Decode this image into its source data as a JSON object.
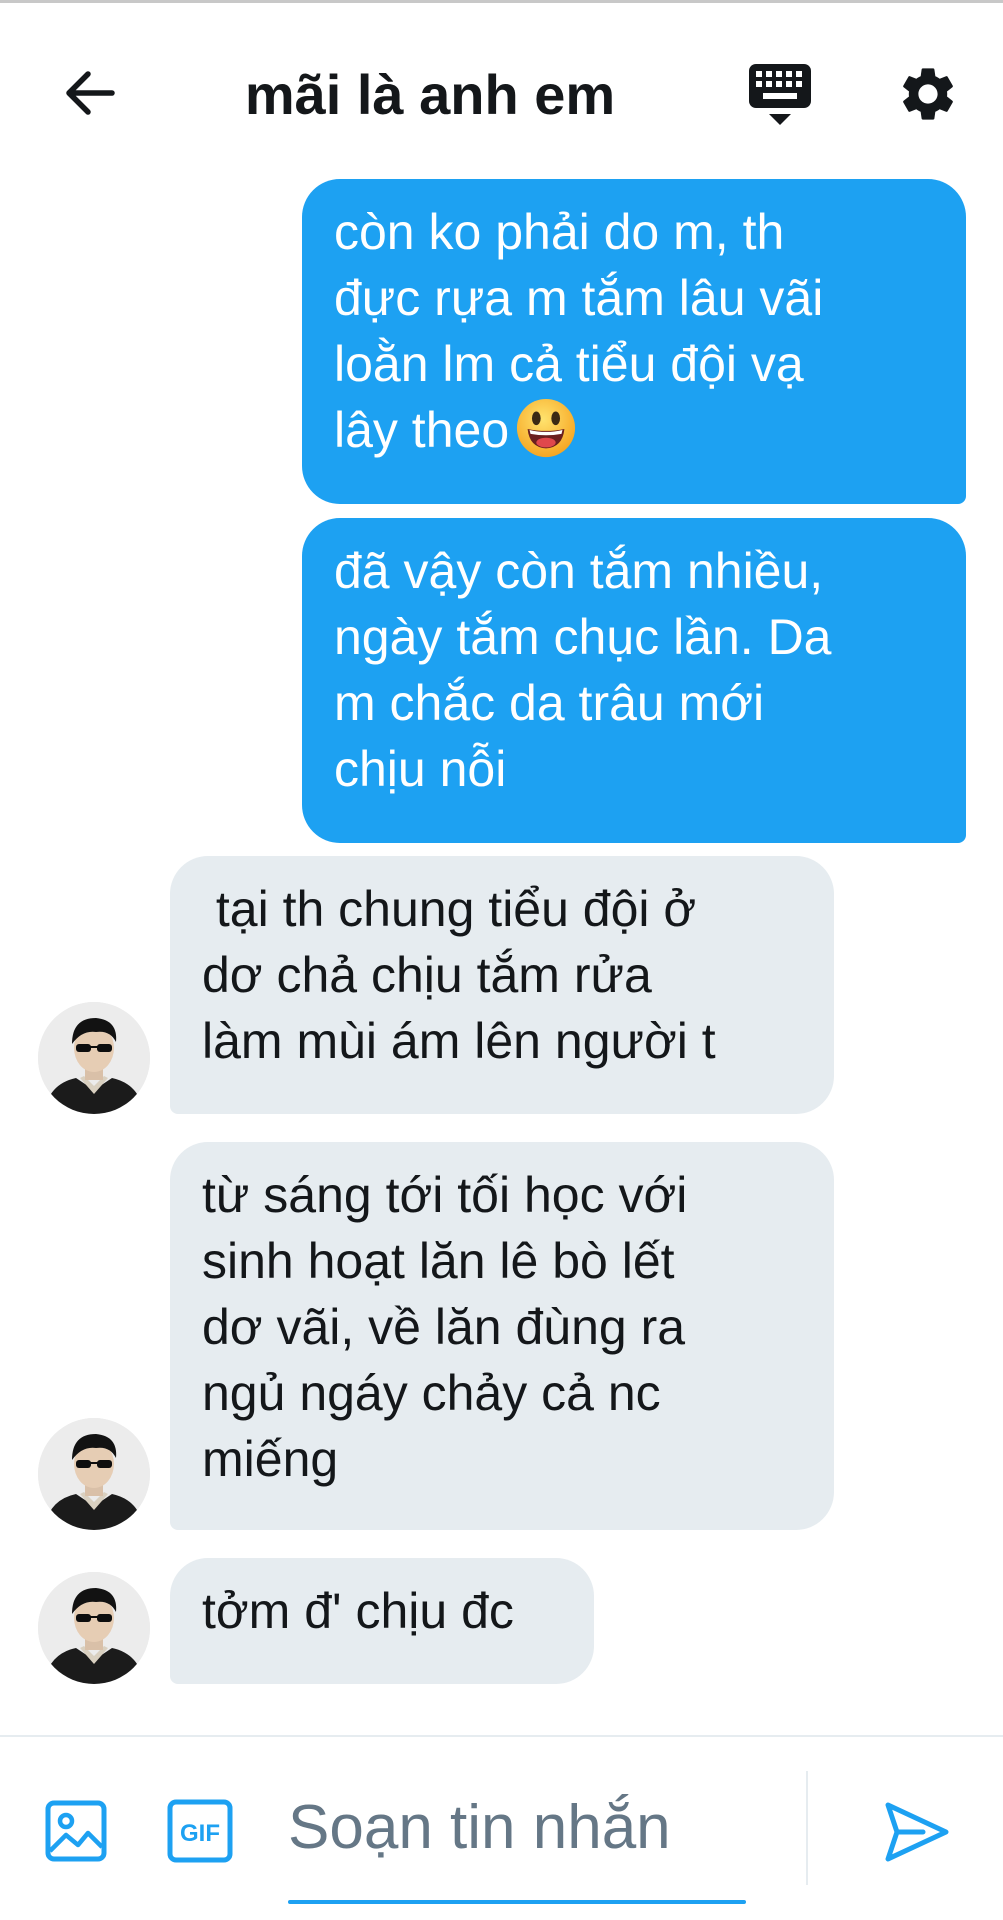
{
  "header": {
    "title": "mãi là anh em",
    "icons": {
      "back": "arrow-left-icon",
      "keyboard": "keyboard-icon",
      "settings": "gear-icon"
    }
  },
  "messages": [
    {
      "direction": "sent",
      "lines": [
        "còn ko phải do m, th",
        "đực rựa m tắm lâu vãi",
        "loằn lm cả tiểu đội vạ",
        "lây theo"
      ],
      "emoji": "grinning-face-emoji"
    },
    {
      "direction": "sent",
      "lines": [
        "đã vậy còn tắm nhiều,",
        "ngày tắm chục lần. Da",
        "m chắc da trâu mới",
        "chịu nỗi"
      ]
    },
    {
      "direction": "received",
      "lines": [
        " tại th chung tiểu đội ở",
        "dơ chả chịu tắm rửa",
        "làm mùi ám lên người t"
      ],
      "avatar": "user-avatar"
    },
    {
      "direction": "received",
      "lines": [
        "từ sáng tới tối học với",
        "sinh hoạt lăn lê bò lết",
        "dơ vãi, về lăn đùng ra",
        "ngủ ngáy chảy cả nc",
        "miếng"
      ],
      "avatar": "user-avatar"
    },
    {
      "direction": "received",
      "lines": [
        "tởm đ' chịu đc"
      ],
      "avatar": "user-avatar"
    }
  ],
  "composer": {
    "placeholder": "Soạn tin nhắn",
    "value": "",
    "gif_label": "GIF",
    "icons": {
      "media": "image-icon",
      "gif": "gif-icon",
      "send": "send-icon"
    }
  },
  "colors": {
    "accent": "#1da1f2",
    "received_bubble": "#e6ecf0",
    "text": "#14171a",
    "placeholder": "#657786"
  }
}
